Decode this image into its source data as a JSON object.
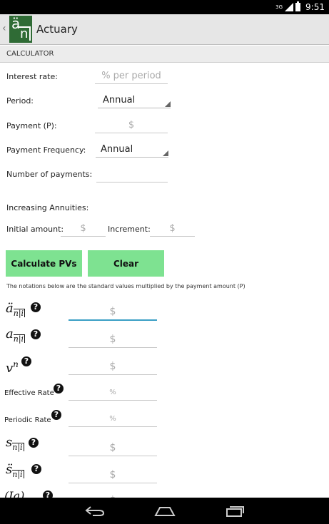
{
  "status": {
    "time": "9:51",
    "network": "3G"
  },
  "app": {
    "title": "Actuary",
    "logo_top": "ä",
    "logo_bottom": "n"
  },
  "section": {
    "title": "CALCULATOR"
  },
  "form": {
    "interest_rate": {
      "label": "Interest rate:",
      "placeholder": "% per period"
    },
    "period": {
      "label": "Period:",
      "value": "Annual"
    },
    "payment": {
      "label": "Payment (P):",
      "placeholder": "$"
    },
    "frequency": {
      "label": "Payment Frequency:",
      "value": "Annual"
    },
    "num_payments": {
      "label": "Number of payments:",
      "placeholder": ""
    },
    "increasing": {
      "label": "Increasing Annuities:"
    },
    "initial_amount": {
      "label": "Initial amount:",
      "placeholder": "$"
    },
    "increment": {
      "label": "Increment:",
      "placeholder": "$"
    }
  },
  "buttons": {
    "calculate": "Calculate PVs",
    "clear": "Clear"
  },
  "note": "The notations below are the standard values multiplied by the payment amount (P)",
  "results": {
    "a_due": {
      "symbol": "ä",
      "sub": "n|i",
      "placeholder": "$"
    },
    "a_imm": {
      "symbol": "a",
      "sub": "n|i",
      "placeholder": "$"
    },
    "vn": {
      "symbol": "v",
      "sup": "n",
      "placeholder": "$"
    },
    "effective": {
      "label": "Effective Rate",
      "placeholder": "%"
    },
    "periodic": {
      "label": "Periodic Rate",
      "placeholder": "%"
    },
    "s_imm": {
      "symbol": "s",
      "sub": "n|i",
      "placeholder": "$"
    },
    "s_due": {
      "symbol": "s̈",
      "sub": "n|i",
      "placeholder": "$"
    },
    "ia": {
      "symbol": "(Ia)",
      "placeholder": "$"
    }
  },
  "help_glyph": "?"
}
